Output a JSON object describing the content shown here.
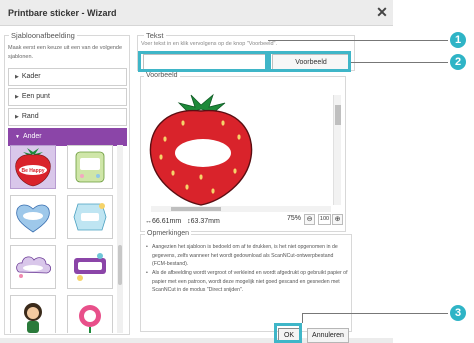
{
  "dialog": {
    "title": "Printbare sticker - Wizard",
    "close_symbol": "✕"
  },
  "template_panel": {
    "legend": "Sjabloonafbeelding",
    "intro": "Maak eerst een keuze uit een van de volgende sjablonen.",
    "categories": [
      {
        "label": "Kader"
      },
      {
        "label": "Een punt"
      },
      {
        "label": "Rand"
      },
      {
        "label": "Ander"
      }
    ],
    "thumbnails": [
      {
        "caption": "Be Happy",
        "shape": "strawberry"
      },
      {
        "caption": "",
        "shape": "ticket"
      },
      {
        "caption": "",
        "shape": "heart"
      },
      {
        "caption": "",
        "shape": "tag"
      },
      {
        "caption": "",
        "shape": "cloud"
      },
      {
        "caption": "",
        "shape": "banner"
      },
      {
        "caption": "",
        "shape": "figure"
      },
      {
        "caption": "",
        "shape": "flower"
      }
    ]
  },
  "text_panel": {
    "legend": "Tekst",
    "hint": "Voer tekst in en klik vervolgens op de knop \"Voorbeeld\".",
    "input_value": "",
    "preview_button": "Voorbeeld"
  },
  "preview_panel": {
    "legend": "Voorbeeld",
    "width": "66.61mm",
    "height": "63.37mm",
    "zoom": "75%",
    "zoom_value": "100"
  },
  "remarks_panel": {
    "legend": "Opmerkingen",
    "items": [
      "Aangezien het sjabloon is bedoeld om af te drukken, is het niet opgenomen in de gegevens, zelfs wanneer het wordt gedownload als ScanNCut-ontwerpbestand (FCM-bestand).",
      "Als de afbeelding wordt vergroot of verkleind en wordt afgedrukt op gebruikt papier of papier met een patroon, wordt deze mogelijk niet goed gescand en gesneden met ScanNCut in de modus \"Direct snijden\"."
    ]
  },
  "footer": {
    "ok": "OK",
    "cancel": "Annuleren"
  },
  "callouts": [
    "1",
    "2",
    "3"
  ],
  "colors": {
    "accent_purple": "#8b45a8",
    "callout_teal": "#2fb4c6",
    "strawberry_red": "#d9232b",
    "leaf_green": "#1e8a3a"
  }
}
